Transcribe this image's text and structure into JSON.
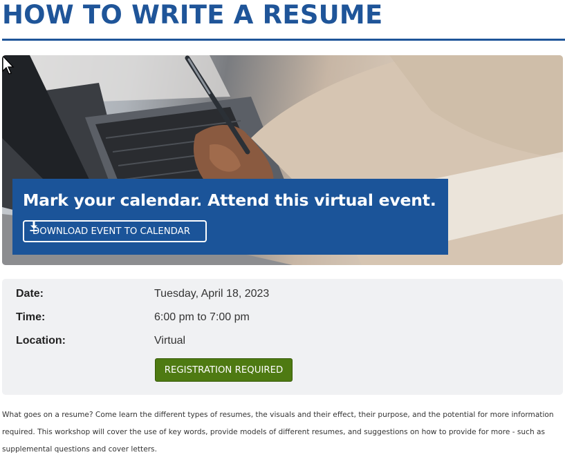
{
  "page": {
    "title": "HOW TO WRITE A RESUME"
  },
  "hero": {
    "image_description_icon": "laptop-writing-photo",
    "heading": "Mark your calendar. Attend this virtual event.",
    "download_button_label": "DOWNLOAD EVENT TO CALENDAR",
    "download_icon": "download-icon"
  },
  "details": {
    "date_label": "Date:",
    "date_value": "Tuesday, April 18, 2023",
    "time_label": "Time:",
    "time_value": "6:00 pm to 7:00 pm",
    "location_label": "Location:",
    "location_value": "Virtual",
    "registration_button_label": "REGISTRATION REQUIRED"
  },
  "description": "What goes on a resume? Come learn the different types of resumes, the visuals and their effect, their purpose, and the potential for more information required. This workshop will cover the use of key words, provide models of different resumes, and suggestions on how to provide for more - such as supplemental questions and cover letters.",
  "colors": {
    "title_blue": "#1f5599",
    "banner_blue": "#1b5499",
    "registration_green": "#4e7a12",
    "details_background": "#f0f1f3"
  }
}
